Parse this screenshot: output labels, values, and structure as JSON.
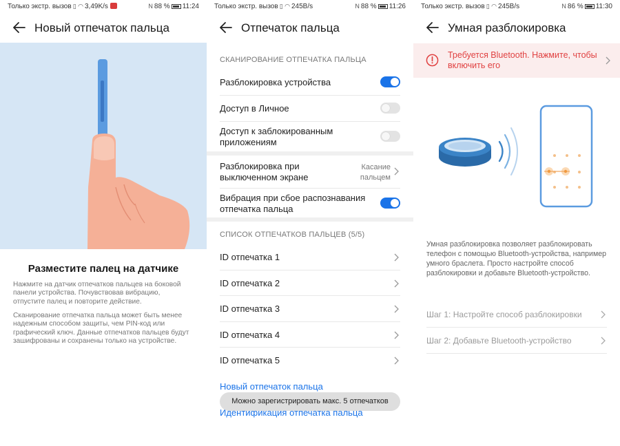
{
  "screens": [
    {
      "status": {
        "carrier": "Только экстр. вызов",
        "speed": "3,49K/s",
        "battery": "88 %",
        "time": "11:24"
      },
      "title": "Новый отпечаток пальца",
      "heading": "Разместите палец на датчике",
      "paragraph1": "Нажмите на датчик отпечатков пальцев на боковой панели устройства. Почувствовав вибрацию, отпустите палец и повторите действие.",
      "paragraph2": "Сканирование отпечатка пальца может быть менее надежным способом защиты, чем PIN-код или графический ключ. Данные отпечатков пальцев будут зашифрованы и сохранены только на устройстве."
    },
    {
      "status": {
        "carrier": "Только экстр. вызов",
        "speed": "245B/s",
        "battery": "88 %",
        "time": "11:26"
      },
      "title": "Отпечаток пальца",
      "section1": "СКАНИРОВАНИЕ ОТПЕЧАТКА ПАЛЬЦА",
      "settings": [
        {
          "label": "Разблокировка устройства",
          "state": "on"
        },
        {
          "label": "Доступ в Личное",
          "state": "off"
        },
        {
          "label": "Доступ к заблокированным приложениям",
          "state": "off"
        }
      ],
      "screen_off": {
        "label": "Разблокировка при выключенном экране",
        "value": "Касание пальцем"
      },
      "vibration": {
        "label": "Вибрация при сбое распознавания отпечатка пальца",
        "state": "on"
      },
      "section2": "СПИСОК ОТПЕЧАТКОВ ПАЛЬЦЕВ (5/5)",
      "fingerprints": [
        "ID отпечатка 1",
        "ID отпечатка 2",
        "ID отпечатка 3",
        "ID отпечатка 4",
        "ID отпечатка 5"
      ],
      "new_link": "Новый отпечаток пальца",
      "ident_link": "Идентификация отпечатка пальца",
      "toast": "Можно зарегистрировать макс. 5 отпечатков"
    },
    {
      "status": {
        "carrier": "Только экстр. вызов",
        "speed": "245B/s",
        "battery": "86 %",
        "time": "11:30"
      },
      "title": "Умная разблокировка",
      "banner": "Требуется Bluetooth. Нажмите, чтобы включить его",
      "description": "Умная разблокировка позволяет разблокировать телефон с помощью Bluetooth-устройства, например умного браслета. Просто настройте способ разблокировки и добавьте Bluetooth-устройство.",
      "steps": [
        "Шаг 1: Настройте способ разблокировки",
        "Шаг 2: Добавьте Bluetooth-устройство"
      ]
    }
  ],
  "colors": {
    "accent": "#1a73e8",
    "warning": "#e04040",
    "banner_bg": "#fbeded",
    "illustration_bg": "#d6e6f5"
  }
}
